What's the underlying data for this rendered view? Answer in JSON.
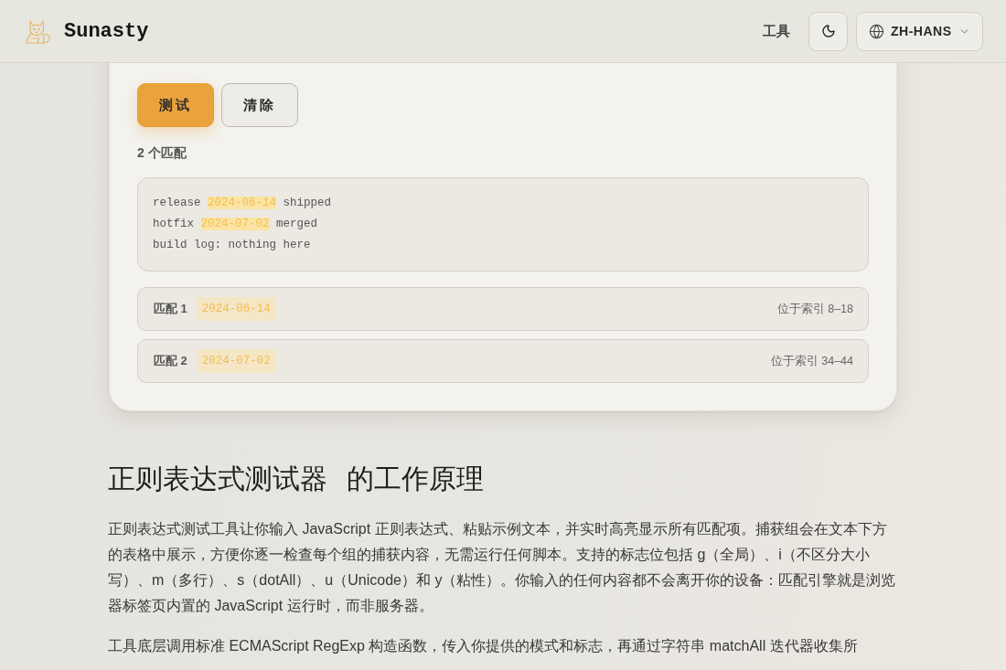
{
  "header": {
    "brand": "Sunasty",
    "nav_links": [
      {
        "label": "工具"
      }
    ],
    "language": "ZH-HANS"
  },
  "actions": [
    {
      "label": "测试",
      "kind": "primary"
    },
    {
      "label": "清除",
      "kind": "secondary"
    }
  ],
  "match_count": "2 个匹配",
  "test_text": {
    "lines": [
      {
        "segments": [
          {
            "text": "release ",
            "highlighted": false
          },
          {
            "text": "2024-06-14",
            "highlighted": true
          },
          {
            "text": " shipped",
            "highlighted": false
          }
        ]
      },
      {
        "segments": [
          {
            "text": "hotfix ",
            "highlighted": false
          },
          {
            "text": "2024-07-02",
            "highlighted": true
          },
          {
            "text": " merged",
            "highlighted": false
          }
        ]
      },
      {
        "segments": [
          {
            "text": "build log: nothing here",
            "highlighted": false
          }
        ]
      }
    ]
  },
  "matches": [
    {
      "label": "匹配 1",
      "value": "2024-06-14",
      "position": "位于索引 8–18"
    },
    {
      "label": "匹配 2",
      "value": "2024-07-02",
      "position": "位于索引 34–44"
    }
  ],
  "article": {
    "heading": "正则表达式测试器 的工作原理",
    "paragraphs": [
      "正则表达式测试工具让你输入 JavaScript 正则表达式、粘贴示例文本，并实时高亮显示所有匹配项。捕获组会在文本下方的表格中展示，方便你逐一检查每个组的捕获内容，无需运行任何脚本。支持的标志位包括 g（全局）、i（不区分大小写）、m（多行）、s（dotAll）、u（Unicode）和 y（粘性）。你输入的任何内容都不会离开你的设备：匹配引擎就是浏览器标签页内置的 JavaScript 运行时，而非服务器。",
      "工具底层调用标准 ECMAScript RegExp 构造函数，传入你提供的模式和标志，再通过字符串 matchAll 迭代器收集所"
    ]
  }
}
